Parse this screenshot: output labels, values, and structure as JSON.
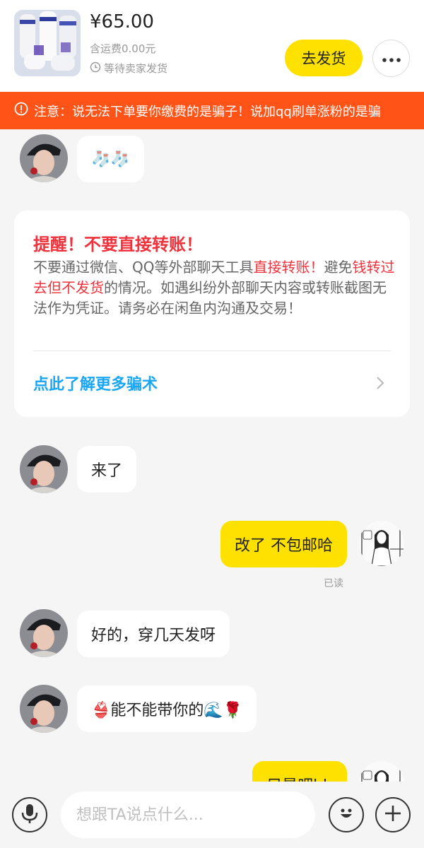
{
  "order": {
    "price": "¥65.00",
    "shipping_fee": "含运费0.00元",
    "status": "等待卖家发货",
    "ship_button": "去发货"
  },
  "warning_banner": {
    "text": "注意：说无法下单要你缴费的是骗子！说加qq刷单涨粉的是骗"
  },
  "reminder_card": {
    "title": "提醒！不要直接转账！",
    "body_parts": [
      "不要通过微信、QQ等外部聊天工具",
      "直接转账！",
      "避免",
      "钱转过去但不发货",
      "的情况。如遇纠纷外部聊天内容或转账截图无法作为凭证。请务必在闲鱼内沟通及交易！"
    ],
    "link": "点此了解更多骗术"
  },
  "messages": [
    {
      "from": "other",
      "text": "🧦🧦"
    },
    {
      "from": "other",
      "text": "来了"
    },
    {
      "from": "me",
      "text": "改了 不包邮哈"
    },
    {
      "from": "other",
      "text": "好的，穿几天发呀"
    },
    {
      "from": "other",
      "text": "👙能不能带你的🌊🌹"
    },
    {
      "from": "me",
      "text": "只是吧hh"
    }
  ],
  "read_receipt": "已读",
  "composer": {
    "placeholder": "想跟TA说点什么..."
  },
  "icons": {
    "status": "clock-icon",
    "more": "more-dots-icon",
    "warning": "alert-circle-icon",
    "voice": "microphone-icon",
    "emoji": "emoji-icon",
    "add": "plus-icon"
  },
  "colors": {
    "accent_yellow": "#ffe100",
    "warning_orange": "#ff5317",
    "alert_red": "#f0323c",
    "link_blue": "#1aa6f2",
    "background": "#f5f5f5"
  }
}
